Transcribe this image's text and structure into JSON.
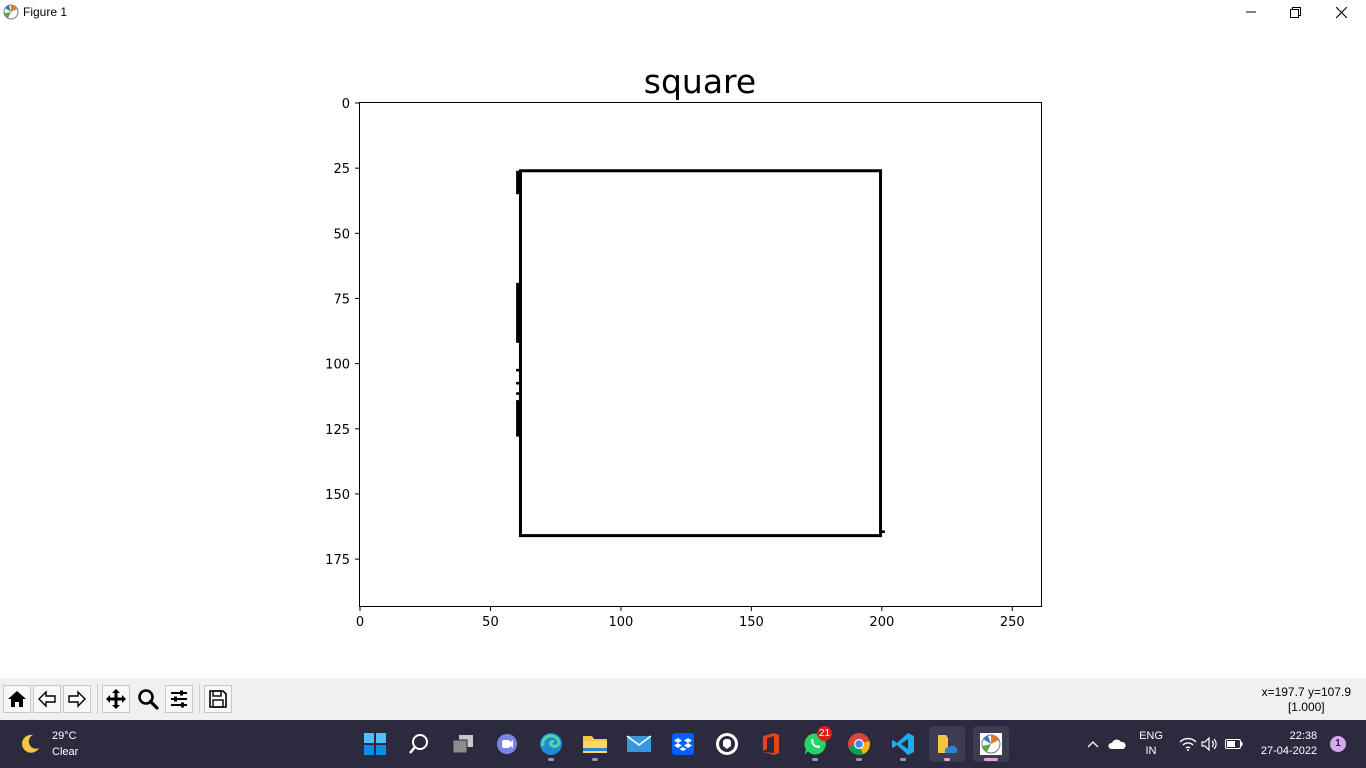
{
  "window": {
    "title": "Figure 1",
    "controls": [
      "minimize",
      "restore",
      "close"
    ]
  },
  "chart_data": {
    "type": "image",
    "title": "square",
    "xlabel": "",
    "ylabel": "",
    "xlim": [
      0,
      261
    ],
    "ylim": [
      193,
      0
    ],
    "y_inverted": true,
    "xticks": [
      0,
      50,
      100,
      150,
      200,
      250
    ],
    "yticks": [
      0,
      25,
      50,
      75,
      100,
      125,
      150,
      175
    ],
    "grid": false,
    "image_background": "white",
    "shapes": [
      {
        "name": "square outline",
        "type": "rectangle",
        "x": [
          61.5,
          199.5
        ],
        "y": [
          26,
          166
        ],
        "color": "#000000"
      }
    ],
    "artifacts": [
      {
        "type": "segment",
        "x": 60.5,
        "y": [
          26,
          35
        ]
      },
      {
        "type": "segment",
        "x": 60.5,
        "y": [
          69,
          92
        ]
      },
      {
        "type": "segment",
        "x": 60.5,
        "y": [
          102,
          103
        ]
      },
      {
        "type": "segment",
        "x": 60.5,
        "y": [
          107,
          108
        ]
      },
      {
        "type": "segment",
        "x": 60.5,
        "y": [
          111,
          112
        ]
      },
      {
        "type": "segment",
        "x": 60.5,
        "y": [
          114,
          128
        ]
      },
      {
        "type": "segment",
        "x": 200.5,
        "y": [
          164,
          165
        ]
      }
    ]
  },
  "toolbar": {
    "buttons": [
      {
        "icon": "home-icon",
        "tooltip": "Reset original view"
      },
      {
        "icon": "back-icon",
        "tooltip": "Back to previous view"
      },
      {
        "icon": "forward-icon",
        "tooltip": "Forward to next view"
      },
      {
        "icon": "pan-icon",
        "tooltip": "Pan axes"
      },
      {
        "icon": "zoom-icon",
        "tooltip": "Zoom to rectangle"
      },
      {
        "icon": "configure-subplots-icon",
        "tooltip": "Configure subplots"
      },
      {
        "icon": "save-icon",
        "tooltip": "Save the figure"
      }
    ],
    "coords_line1": "x=197.7 y=107.9",
    "coords_line2": "[1.000]"
  },
  "taskbar": {
    "weather_temp": "29°C",
    "weather_cond": "Clear",
    "apps": [
      {
        "name": "start",
        "icon": "windows-start-icon"
      },
      {
        "name": "search",
        "icon": "search-icon"
      },
      {
        "name": "task-view",
        "icon": "task-view-icon"
      },
      {
        "name": "teams-chat",
        "icon": "teams-chat-icon"
      },
      {
        "name": "edge",
        "icon": "edge-icon"
      },
      {
        "name": "file-explorer",
        "icon": "folder-icon"
      },
      {
        "name": "mail",
        "icon": "mail-icon"
      },
      {
        "name": "dropbox",
        "icon": "dropbox-icon"
      },
      {
        "name": "github-desktop",
        "icon": "github-icon"
      },
      {
        "name": "office",
        "icon": "office-icon"
      },
      {
        "name": "whatsapp",
        "icon": "whatsapp-icon"
      },
      {
        "name": "chrome",
        "icon": "chrome-icon"
      },
      {
        "name": "vscode",
        "icon": "vscode-icon"
      },
      {
        "name": "onedrive-folder",
        "icon": "onedrive-folder-icon"
      },
      {
        "name": "matplotlib-figure",
        "icon": "matplotlib-icon"
      }
    ],
    "whatsapp_badge": "21",
    "lang_line1": "ENG",
    "lang_line2": "IN",
    "time": "22:38",
    "date": "27-04-2022",
    "notification_count": "1"
  }
}
